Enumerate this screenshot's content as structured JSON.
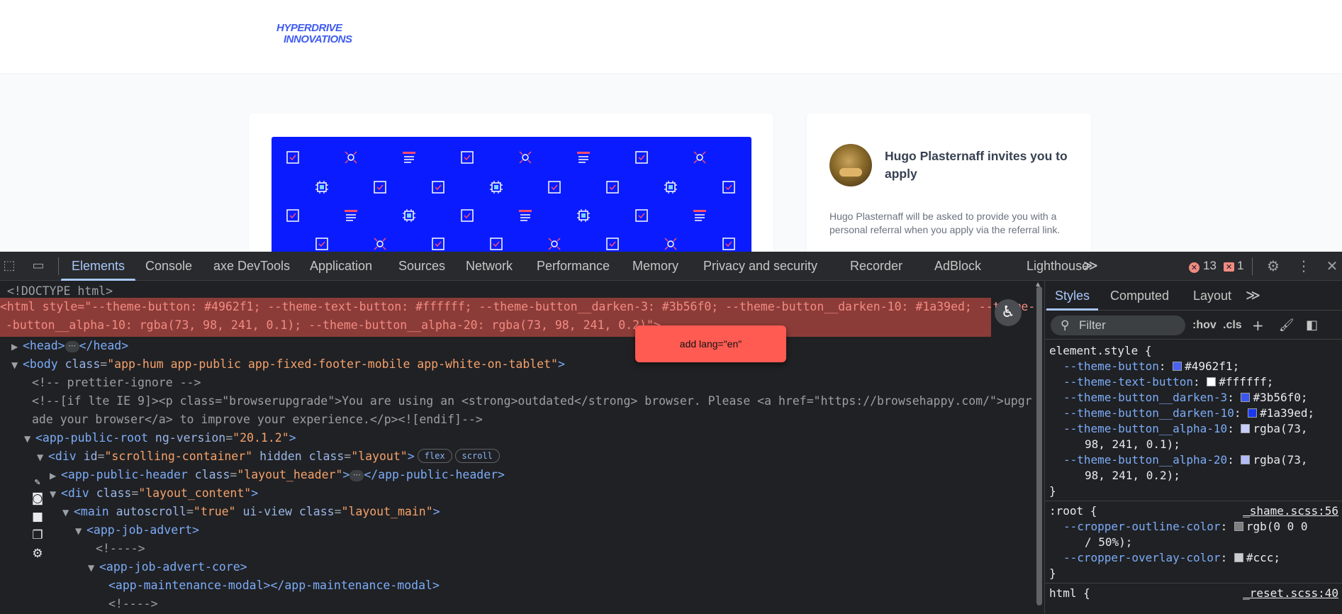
{
  "page": {
    "logo": {
      "line1": "HYPERDRIVE",
      "line2": "INNOVATIONS"
    },
    "invite": {
      "title": "Hugo Plasternaff invites you to apply",
      "text": "Hugo Plasternaff will be asked to provide you with a personal referral when you apply via the referral link."
    },
    "colors": {
      "banner": "#0a1cff",
      "accent": "#3f5bf0"
    }
  },
  "devtools": {
    "tabs": [
      {
        "label": "Elements",
        "active": true
      },
      {
        "label": "Console"
      },
      {
        "label": "axe DevTools"
      },
      {
        "label": "Application"
      },
      {
        "label": "Sources"
      },
      {
        "label": "Network"
      },
      {
        "label": "Performance"
      },
      {
        "label": "Memory"
      },
      {
        "label": "Privacy and security"
      },
      {
        "label": "Recorder"
      },
      {
        "label": "AdBlock"
      },
      {
        "label": "Lighthouse"
      }
    ],
    "more_tabs": "≫",
    "errors": "13",
    "issues": "1",
    "tooltip": "add lang=\"en\"",
    "dom": {
      "doctype": "<!DOCTYPE html>",
      "html_line1": "<html style=\"--theme-button: #4962f1; --theme-text-button: #ffffff; --theme-button__darken-3: #3b56f0; --theme-button__darken-10: #1a39ed; --theme-",
      "html_line2": "-button__alpha-10: rgba(73, 98, 241, 0.1); --theme-button__alpha-20: rgba(73, 98, 241, 0.2)\">",
      "head": {
        "open": "<head>",
        "close": "</head>"
      },
      "body": {
        "tag": "<body",
        "attr": "class",
        "val": "\"app-hum app-public app-fixed-footer-mobile app-white-on-tablet\"",
        "end": ">"
      },
      "comment1": "<!-- prettier-ignore -->",
      "comment2a": "<!--[if lte IE 9]><p class=\"browserupgrade\">You are using an <strong>outdated</strong> browser. Please <a href=\"https://browsehappy.com/\">upgr",
      "comment2b": "ade your browser</a> to improve your experience.</p><![endif]-->",
      "root": {
        "tag": "<app-public-root",
        "attr": "ng-version",
        "val": "\"20.1.2\"",
        "end": ">"
      },
      "div1": {
        "tag": "<div",
        "attr1": "id",
        "val1": "\"scrolling-container\"",
        "attr2": "hidden class",
        "val2": "\"layout\"",
        "end": ">",
        "badges": [
          "flex",
          "scroll"
        ]
      },
      "header": {
        "tag": "<app-public-header",
        "attr": "class",
        "val": "\"layout_header\"",
        "end": ">",
        "close": "</app-public-header>"
      },
      "div2": {
        "tag": "<div",
        "attr": "class",
        "val": "\"layout_content\"",
        "end": ">"
      },
      "main": {
        "tag": "<main",
        "attr1": "autoscroll",
        "val1": "\"true\"",
        "attr2": "ui-view class",
        "val2": "\"layout_main\"",
        "end": ">"
      },
      "advert": "<app-job-advert>",
      "comment3": "<!---->",
      "core": "<app-job-advert-core>",
      "modal": "<app-maintenance-modal></app-maintenance-modal>",
      "comment4": "<!---->"
    },
    "styles": {
      "tabs": [
        "Styles",
        "Computed",
        "Layout"
      ],
      "more": "≫",
      "filter_placeholder": "Filter",
      "hov": ":hov",
      "cls": ".cls",
      "element_style": "element.style {",
      "props": [
        {
          "name": "--theme-button",
          "value": "#4962f1",
          "swatch": "#4962f1"
        },
        {
          "name": "--theme-text-button",
          "value": "#ffffff",
          "swatch": "#ffffff"
        },
        {
          "name": "--theme-button__darken-3",
          "value": "#3b56f0",
          "swatch": "#3b56f0"
        },
        {
          "name": "--theme-button__darken-10",
          "value": "#1a39ed",
          "swatch": "#1a39ed"
        },
        {
          "name": "--theme-button__alpha-10",
          "value": "rgba(73,",
          "value2": "98, 241, 0.1);",
          "swatch": "#c7cef9"
        },
        {
          "name": "--theme-button__alpha-20",
          "value": "rgba(73,",
          "value2": "98, 241, 0.2);",
          "swatch": "#b2bcf7"
        }
      ],
      "close_brace": "}",
      "root_rule": ":root {",
      "root_source": "_shame.scss:56",
      "root_props": [
        {
          "name": "--cropper-outline-color",
          "value": "rgb(0 0 0",
          "value2": "/ 50%);",
          "swatch": "#7f7f7f"
        },
        {
          "name": "--cropper-overlay-color",
          "value": "#ccc;",
          "swatch": "#cccccc"
        }
      ],
      "html_rule": "html {",
      "html_source": "_reset.scss:40"
    }
  }
}
